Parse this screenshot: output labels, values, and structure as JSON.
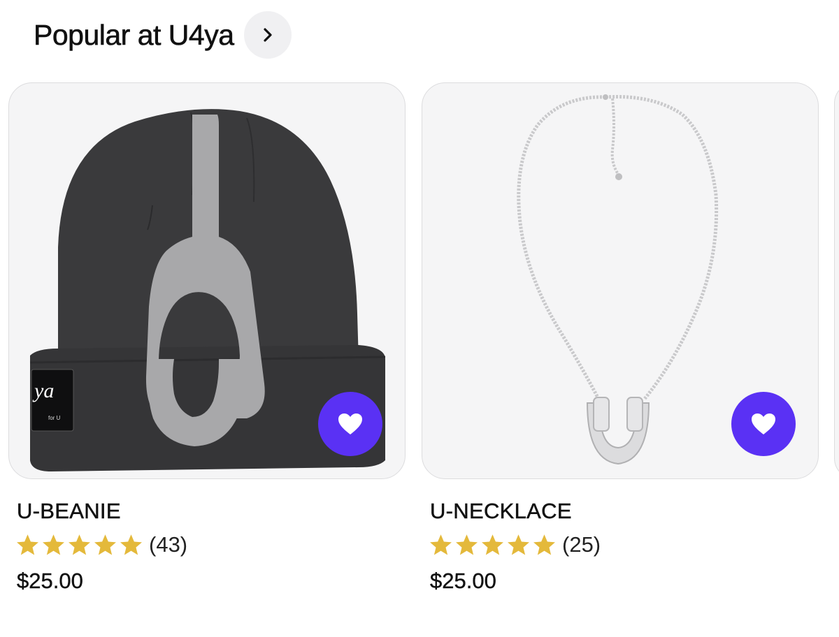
{
  "section": {
    "title": "Popular at U4ya",
    "arrow_icon": "chevron-right-icon"
  },
  "colors": {
    "accent": "#5a31f4",
    "star": "#e4b93b"
  },
  "products": [
    {
      "name": "U-BEANIE",
      "rating": 5,
      "rating_count": "(43)",
      "price": "$25.00",
      "label_text": "ya",
      "label_subtext": "for U"
    },
    {
      "name": "U-NECKLACE",
      "rating": 5,
      "rating_count": "(25)",
      "price": "$25.00"
    }
  ]
}
